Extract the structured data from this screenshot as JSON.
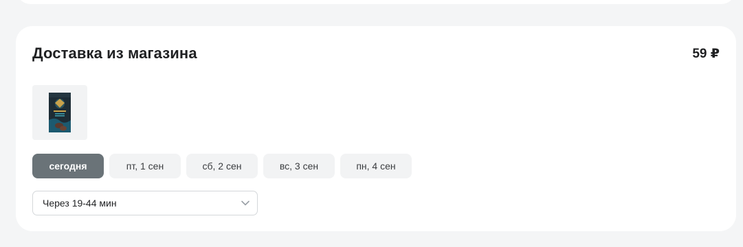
{
  "delivery": {
    "title": "Доставка из магазина",
    "price": "59 ₽",
    "product_image": "coffee-package",
    "date_tabs": [
      {
        "label": "сегодня",
        "active": true
      },
      {
        "label": "пт, 1 сен",
        "active": false
      },
      {
        "label": "сб, 2 сен",
        "active": false
      },
      {
        "label": "вс, 3 сен",
        "active": false
      },
      {
        "label": "пн, 4 сен",
        "active": false
      }
    ],
    "time_select": {
      "value": "Через 19-44 мин",
      "icon": "chevron-down-icon"
    }
  },
  "colors": {
    "background": "#f4f5f6",
    "card": "#ffffff",
    "active_tab": "#6a7378",
    "inactive_tab": "#f2f3f4"
  }
}
